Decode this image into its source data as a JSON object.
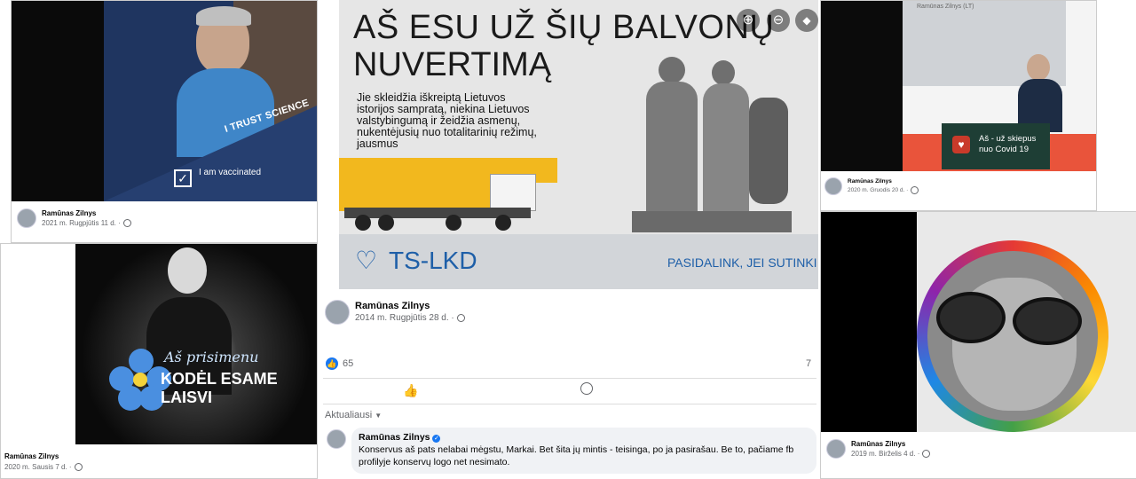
{
  "panel1": {
    "banner_text": "I TRUST SCIENCE",
    "badge_text": "I am vaccinated",
    "author": "Ramūnas Zilnys",
    "date": "2021 m. Rugpjūtis 11 d. ·"
  },
  "panel2": {
    "overlay_line1": "Aš prisimenu",
    "overlay_line2": "KODĖL ESAME LAISVI",
    "author": "Ramūnas Zilnys",
    "date": "2020 m. Sausis 7 d. ·"
  },
  "panel3": {
    "headline_1": "AŠ ESU UŽ ŠIŲ BALVONŲ",
    "headline_2": "NUVERTIMĄ",
    "body": "Jie skleidžia iškreiptą Lietuvos istorijos sampratą, niekina Lietuvos valstybingumą ir žeidžia asmenų, nukentėjusių nuo totalitarinių režimų, jausmus",
    "logo": "TS-LKD",
    "share_text": "PASIDALINK, JEI SUTINKI",
    "author": "Ramūnas Zilnys",
    "date": "2014 m. Rugpjūtis 28 d. ·",
    "likes": "65",
    "comments_count": "7",
    "sort_label": "Aktualiausi",
    "comment": {
      "author": "Ramūnas Zilnys",
      "text": "Konservus aš pats nelabai mėgstu, Markai. Bet šita jų mintis - teisinga, po ja pasirašau. Be to, pačiame fb profilyje konservų logo net nesimato."
    }
  },
  "panel4": {
    "screen_title": "Ramūnas Zilnys (LT)",
    "sign_text": "Aš - už skiepus nuo Covid 19",
    "author": "Ramūnas Zilnys",
    "date": "2020 m. Gruodis 20 d. ·"
  },
  "panel5": {
    "author": "Ramūnas Zilnys",
    "date": "2019 m. Birželis 4 d. ·"
  },
  "colors": {
    "navy": "#1f3560",
    "fb_blue": "#1877f2",
    "tslkd_blue": "#1e5fa8",
    "sign_red": "#c93a2a",
    "crane_yellow": "#f2b81e"
  }
}
